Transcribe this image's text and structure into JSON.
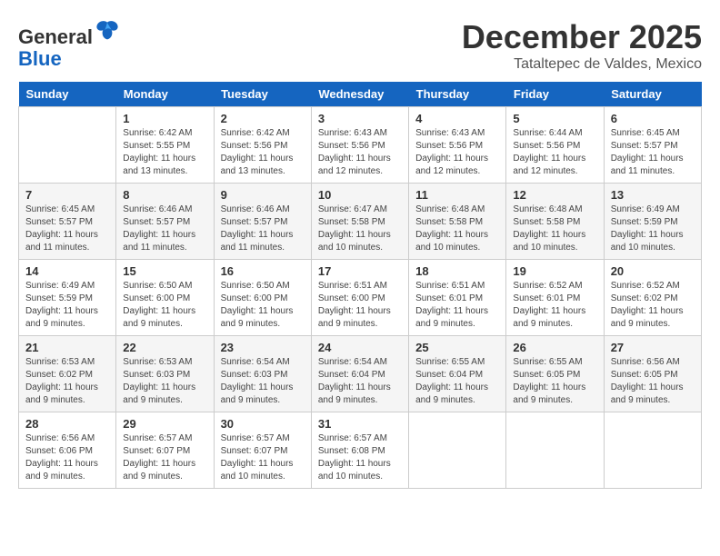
{
  "header": {
    "logo_line1": "General",
    "logo_line2": "Blue",
    "month": "December 2025",
    "location": "Tataltepec de Valdes, Mexico"
  },
  "days_of_week": [
    "Sunday",
    "Monday",
    "Tuesday",
    "Wednesday",
    "Thursday",
    "Friday",
    "Saturday"
  ],
  "weeks": [
    [
      {
        "num": "",
        "info": ""
      },
      {
        "num": "1",
        "info": "Sunrise: 6:42 AM\nSunset: 5:55 PM\nDaylight: 11 hours\nand 13 minutes."
      },
      {
        "num": "2",
        "info": "Sunrise: 6:42 AM\nSunset: 5:56 PM\nDaylight: 11 hours\nand 13 minutes."
      },
      {
        "num": "3",
        "info": "Sunrise: 6:43 AM\nSunset: 5:56 PM\nDaylight: 11 hours\nand 12 minutes."
      },
      {
        "num": "4",
        "info": "Sunrise: 6:43 AM\nSunset: 5:56 PM\nDaylight: 11 hours\nand 12 minutes."
      },
      {
        "num": "5",
        "info": "Sunrise: 6:44 AM\nSunset: 5:56 PM\nDaylight: 11 hours\nand 12 minutes."
      },
      {
        "num": "6",
        "info": "Sunrise: 6:45 AM\nSunset: 5:57 PM\nDaylight: 11 hours\nand 11 minutes."
      }
    ],
    [
      {
        "num": "7",
        "info": "Sunrise: 6:45 AM\nSunset: 5:57 PM\nDaylight: 11 hours\nand 11 minutes."
      },
      {
        "num": "8",
        "info": "Sunrise: 6:46 AM\nSunset: 5:57 PM\nDaylight: 11 hours\nand 11 minutes."
      },
      {
        "num": "9",
        "info": "Sunrise: 6:46 AM\nSunset: 5:57 PM\nDaylight: 11 hours\nand 11 minutes."
      },
      {
        "num": "10",
        "info": "Sunrise: 6:47 AM\nSunset: 5:58 PM\nDaylight: 11 hours\nand 10 minutes."
      },
      {
        "num": "11",
        "info": "Sunrise: 6:48 AM\nSunset: 5:58 PM\nDaylight: 11 hours\nand 10 minutes."
      },
      {
        "num": "12",
        "info": "Sunrise: 6:48 AM\nSunset: 5:58 PM\nDaylight: 11 hours\nand 10 minutes."
      },
      {
        "num": "13",
        "info": "Sunrise: 6:49 AM\nSunset: 5:59 PM\nDaylight: 11 hours\nand 10 minutes."
      }
    ],
    [
      {
        "num": "14",
        "info": "Sunrise: 6:49 AM\nSunset: 5:59 PM\nDaylight: 11 hours\nand 9 minutes."
      },
      {
        "num": "15",
        "info": "Sunrise: 6:50 AM\nSunset: 6:00 PM\nDaylight: 11 hours\nand 9 minutes."
      },
      {
        "num": "16",
        "info": "Sunrise: 6:50 AM\nSunset: 6:00 PM\nDaylight: 11 hours\nand 9 minutes."
      },
      {
        "num": "17",
        "info": "Sunrise: 6:51 AM\nSunset: 6:00 PM\nDaylight: 11 hours\nand 9 minutes."
      },
      {
        "num": "18",
        "info": "Sunrise: 6:51 AM\nSunset: 6:01 PM\nDaylight: 11 hours\nand 9 minutes."
      },
      {
        "num": "19",
        "info": "Sunrise: 6:52 AM\nSunset: 6:01 PM\nDaylight: 11 hours\nand 9 minutes."
      },
      {
        "num": "20",
        "info": "Sunrise: 6:52 AM\nSunset: 6:02 PM\nDaylight: 11 hours\nand 9 minutes."
      }
    ],
    [
      {
        "num": "21",
        "info": "Sunrise: 6:53 AM\nSunset: 6:02 PM\nDaylight: 11 hours\nand 9 minutes."
      },
      {
        "num": "22",
        "info": "Sunrise: 6:53 AM\nSunset: 6:03 PM\nDaylight: 11 hours\nand 9 minutes."
      },
      {
        "num": "23",
        "info": "Sunrise: 6:54 AM\nSunset: 6:03 PM\nDaylight: 11 hours\nand 9 minutes."
      },
      {
        "num": "24",
        "info": "Sunrise: 6:54 AM\nSunset: 6:04 PM\nDaylight: 11 hours\nand 9 minutes."
      },
      {
        "num": "25",
        "info": "Sunrise: 6:55 AM\nSunset: 6:04 PM\nDaylight: 11 hours\nand 9 minutes."
      },
      {
        "num": "26",
        "info": "Sunrise: 6:55 AM\nSunset: 6:05 PM\nDaylight: 11 hours\nand 9 minutes."
      },
      {
        "num": "27",
        "info": "Sunrise: 6:56 AM\nSunset: 6:05 PM\nDaylight: 11 hours\nand 9 minutes."
      }
    ],
    [
      {
        "num": "28",
        "info": "Sunrise: 6:56 AM\nSunset: 6:06 PM\nDaylight: 11 hours\nand 9 minutes."
      },
      {
        "num": "29",
        "info": "Sunrise: 6:57 AM\nSunset: 6:07 PM\nDaylight: 11 hours\nand 9 minutes."
      },
      {
        "num": "30",
        "info": "Sunrise: 6:57 AM\nSunset: 6:07 PM\nDaylight: 11 hours\nand 10 minutes."
      },
      {
        "num": "31",
        "info": "Sunrise: 6:57 AM\nSunset: 6:08 PM\nDaylight: 11 hours\nand 10 minutes."
      },
      {
        "num": "",
        "info": ""
      },
      {
        "num": "",
        "info": ""
      },
      {
        "num": "",
        "info": ""
      }
    ]
  ]
}
